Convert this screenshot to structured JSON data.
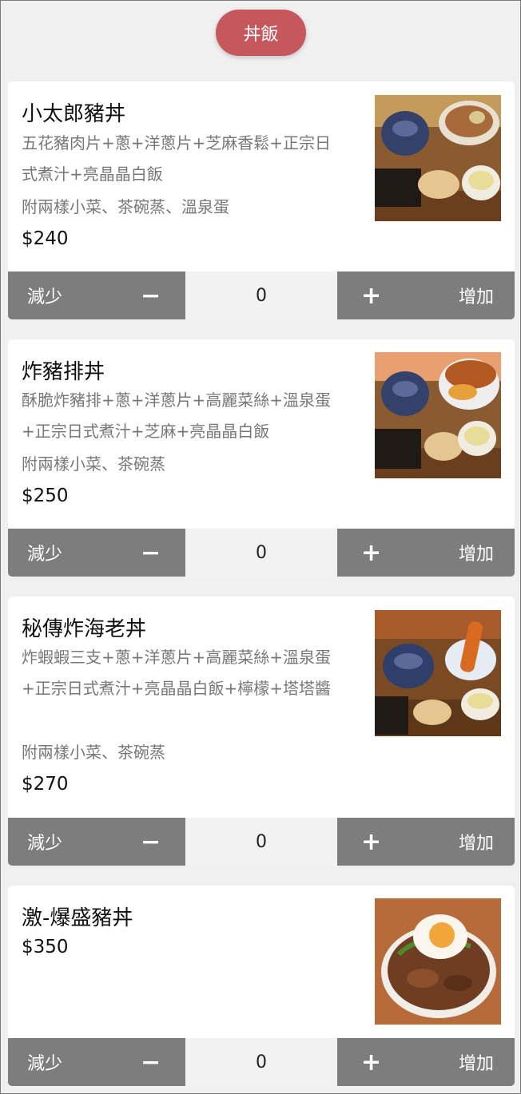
{
  "category": "丼飯",
  "items": [
    {
      "name": "小太郎豬丼",
      "desc": "五花豬肉片+蔥+洋蔥片+芝麻香鬆+正宗日式煮汁+亮晶晶白飯",
      "side": "附兩樣小菜、茶碗蒸、溫泉蛋",
      "price": "$240",
      "qty": "0"
    },
    {
      "name": "炸豬排丼",
      "desc": "酥脆炸豬排+蔥+洋蔥片+高麗菜絲+溫泉蛋+正宗日式煮汁+芝麻+亮晶晶白飯",
      "side": "附兩樣小菜、茶碗蒸",
      "price": "$250",
      "qty": "0"
    },
    {
      "name": "秘傳炸海老丼",
      "desc": "炸蝦蝦三支+蔥+洋蔥片+高麗菜絲+溫泉蛋+正宗日式煮汁+亮晶晶白飯+檸檬+塔塔醬",
      "side": "附兩樣小菜、茶碗蒸",
      "price": "$270",
      "qty": "0"
    },
    {
      "name": "激-爆盛豬丼",
      "price": "$350",
      "qty": "0"
    }
  ],
  "buttons": {
    "decrease_label": "減少",
    "increase_label": "增加",
    "minus_symbol": "−",
    "plus_symbol": "+"
  },
  "colors": {
    "accent": "#c6585d",
    "button": "#7d7d7d",
    "background": "#f0f0f0"
  }
}
